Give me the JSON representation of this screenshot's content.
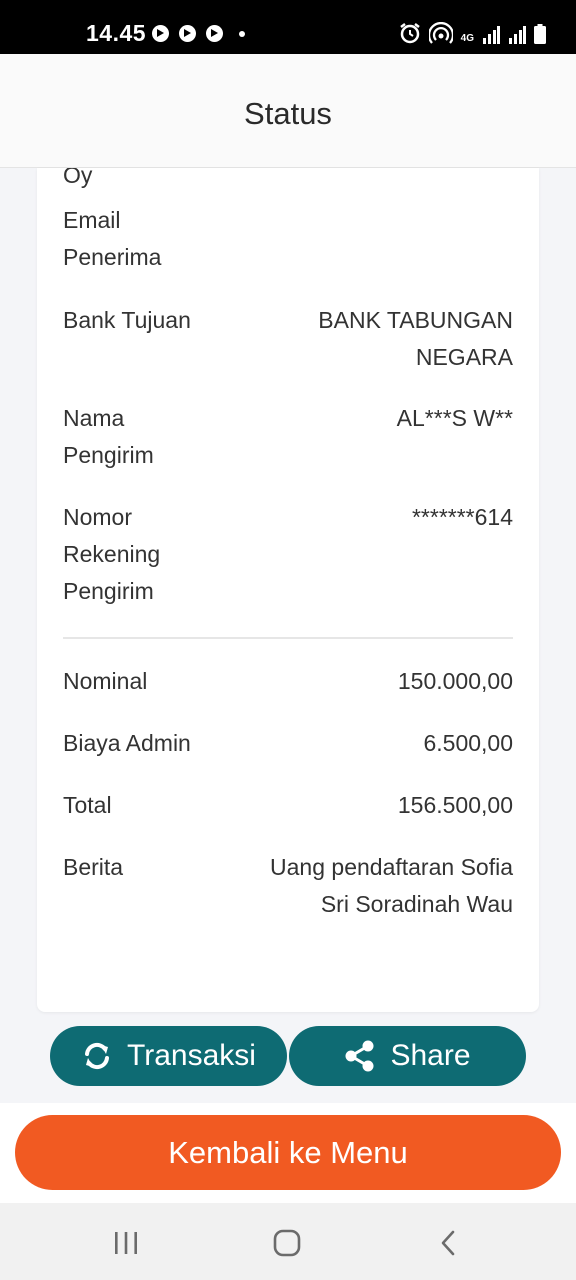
{
  "status_bar": {
    "time": "14.45",
    "network": "4G"
  },
  "header": {
    "title": "Status"
  },
  "details": {
    "cut_off_text": "Oy",
    "email_label": "Email Penerima",
    "email_value": "",
    "bank_label": "Bank Tujuan",
    "bank_value": "BANK TABUNGAN NEGARA",
    "sender_name_label": "Nama Pengirim",
    "sender_name_value": "AL***S W**",
    "sender_account_label": "Nomor Rekening Pengirim",
    "sender_account_value": "*******614",
    "nominal_label": "Nominal",
    "nominal_value": "150.000,00",
    "admin_fee_label": "Biaya Admin",
    "admin_fee_value": "6.500,00",
    "total_label": "Total",
    "total_value": "156.500,00",
    "message_label": "Berita",
    "message_value": "Uang pendaftaran Sofia Sri Soradinah Wau"
  },
  "actions": {
    "transaction_label": "Transaksi",
    "share_label": "Share",
    "back_label": "Kembali ke Menu"
  },
  "icons": {
    "transaction": "refresh-icon",
    "share": "share-icon"
  },
  "colors": {
    "primary_teal": "#0e6b73",
    "accent_orange": "#f15a22"
  }
}
